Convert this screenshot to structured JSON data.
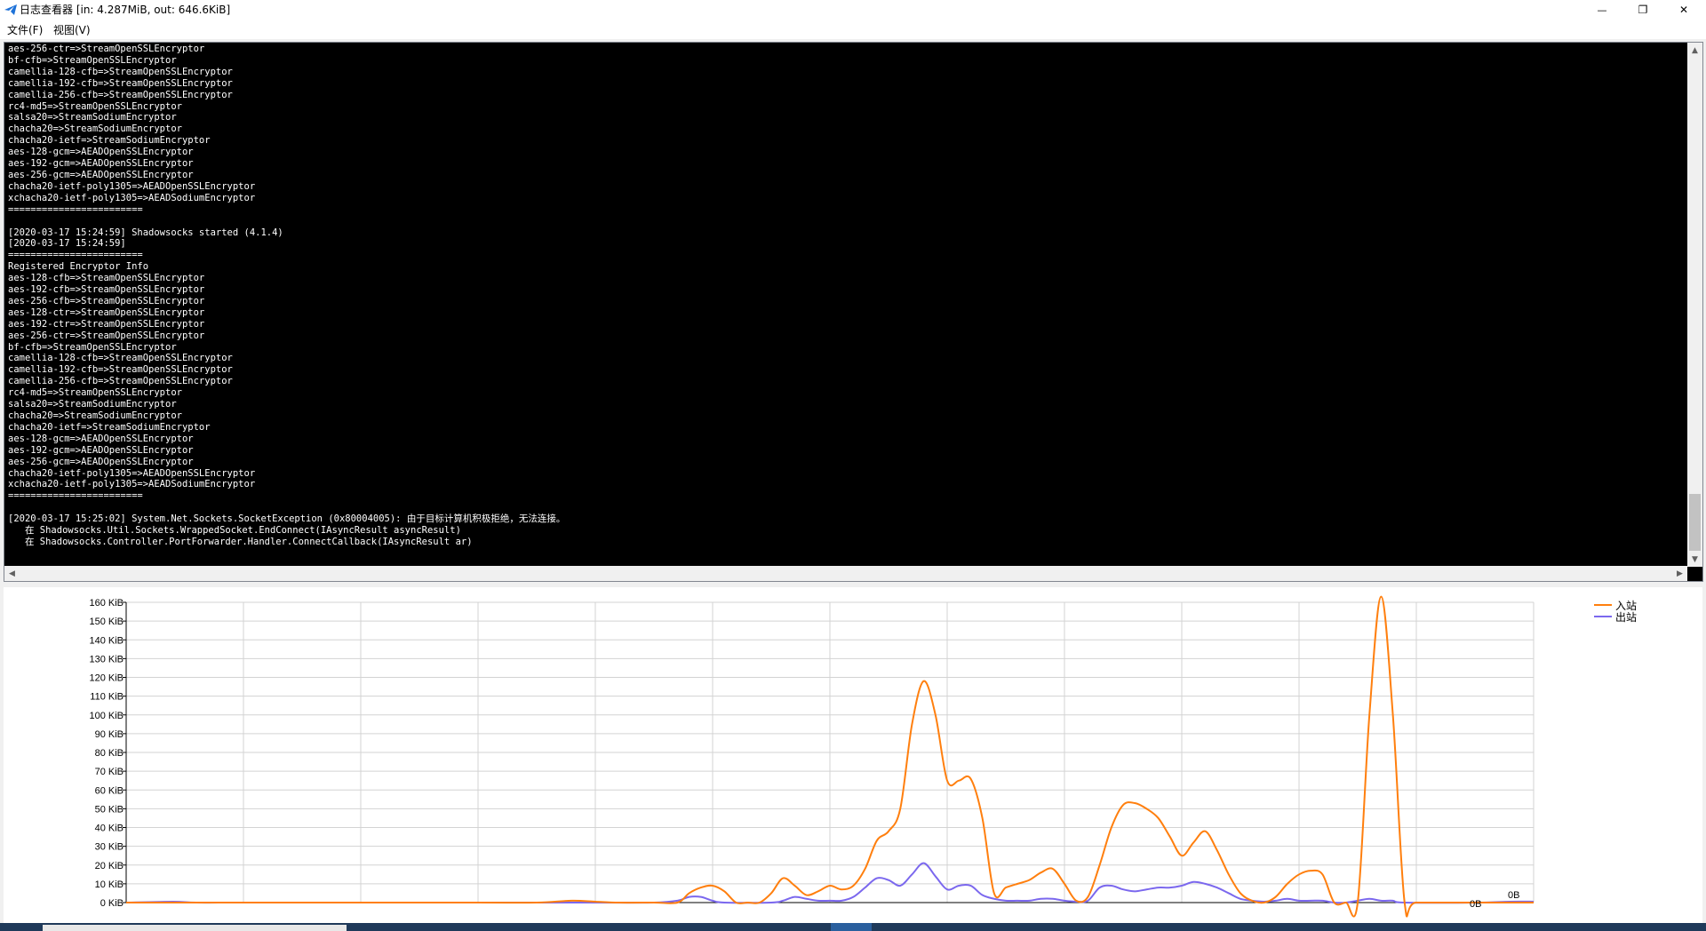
{
  "window": {
    "title": "日志查看器 [in: 4.287MiB, out: 646.6KiB]",
    "minimize_glyph": "—",
    "maximize_glyph": "❐",
    "close_glyph": "✕"
  },
  "menu": {
    "file": "文件(F)",
    "view": "视图(V)"
  },
  "log": {
    "lines": [
      "aes-256-ctr=>StreamOpenSSLEncryptor",
      "bf-cfb=>StreamOpenSSLEncryptor",
      "camellia-128-cfb=>StreamOpenSSLEncryptor",
      "camellia-192-cfb=>StreamOpenSSLEncryptor",
      "camellia-256-cfb=>StreamOpenSSLEncryptor",
      "rc4-md5=>StreamOpenSSLEncryptor",
      "salsa20=>StreamSodiumEncryptor",
      "chacha20=>StreamSodiumEncryptor",
      "chacha20-ietf=>StreamSodiumEncryptor",
      "aes-128-gcm=>AEADOpenSSLEncryptor",
      "aes-192-gcm=>AEADOpenSSLEncryptor",
      "aes-256-gcm=>AEADOpenSSLEncryptor",
      "chacha20-ietf-poly1305=>AEADOpenSSLEncryptor",
      "xchacha20-ietf-poly1305=>AEADSodiumEncryptor",
      "========================",
      "",
      "[2020-03-17 15:24:59] Shadowsocks started (4.1.4)",
      "[2020-03-17 15:24:59]",
      "========================",
      "Registered Encryptor Info",
      "aes-128-cfb=>StreamOpenSSLEncryptor",
      "aes-192-cfb=>StreamOpenSSLEncryptor",
      "aes-256-cfb=>StreamOpenSSLEncryptor",
      "aes-128-ctr=>StreamOpenSSLEncryptor",
      "aes-192-ctr=>StreamOpenSSLEncryptor",
      "aes-256-ctr=>StreamOpenSSLEncryptor",
      "bf-cfb=>StreamOpenSSLEncryptor",
      "camellia-128-cfb=>StreamOpenSSLEncryptor",
      "camellia-192-cfb=>StreamOpenSSLEncryptor",
      "camellia-256-cfb=>StreamOpenSSLEncryptor",
      "rc4-md5=>StreamOpenSSLEncryptor",
      "salsa20=>StreamSodiumEncryptor",
      "chacha20=>StreamSodiumEncryptor",
      "chacha20-ietf=>StreamSodiumEncryptor",
      "aes-128-gcm=>AEADOpenSSLEncryptor",
      "aes-192-gcm=>AEADOpenSSLEncryptor",
      "aes-256-gcm=>AEADOpenSSLEncryptor",
      "chacha20-ietf-poly1305=>AEADOpenSSLEncryptor",
      "xchacha20-ietf-poly1305=>AEADSodiumEncryptor",
      "========================",
      "",
      "[2020-03-17 15:25:02] System.Net.Sockets.SocketException (0x80004005): 由于目标计算机积极拒绝，无法连接。",
      "   在 Shadowsocks.Util.Sockets.WrappedSocket.EndConnect(IAsyncResult asyncResult)",
      "   在 Shadowsocks.Controller.PortForwarder.Handler.ConnectCallback(IAsyncResult ar)"
    ]
  },
  "chart_data": {
    "type": "line",
    "title": "",
    "xlabel": "",
    "ylabel": "",
    "ylim": [
      0,
      160
    ],
    "yticks": [
      "0 KiB",
      "10 KiB",
      "20 KiB",
      "30 KiB",
      "40 KiB",
      "50 KiB",
      "60 KiB",
      "70 KiB",
      "80 KiB",
      "90 KiB",
      "100 KiB",
      "110 KiB",
      "120 KiB",
      "130 KiB",
      "140 KiB",
      "150 KiB",
      "160 KiB"
    ],
    "xlim": [
      0,
      120
    ],
    "grid": true,
    "legend_position": "top-right",
    "series": [
      {
        "name": "入站",
        "color": "#ff7f0e",
        "points": [
          [
            0,
            0
          ],
          [
            5,
            0
          ],
          [
            10,
            0
          ],
          [
            20,
            0
          ],
          [
            30,
            0
          ],
          [
            35,
            0
          ],
          [
            38,
            1
          ],
          [
            40,
            0.5
          ],
          [
            42,
            0
          ],
          [
            45,
            0
          ],
          [
            47,
            0
          ],
          [
            48,
            5
          ],
          [
            49,
            8
          ],
          [
            50,
            9
          ],
          [
            51,
            6
          ],
          [
            52,
            0
          ],
          [
            53,
            0
          ],
          [
            54,
            0
          ],
          [
            55,
            5
          ],
          [
            56,
            13
          ],
          [
            57,
            9
          ],
          [
            58,
            4
          ],
          [
            59,
            6
          ],
          [
            60,
            9
          ],
          [
            61,
            7
          ],
          [
            62,
            9
          ],
          [
            63,
            18
          ],
          [
            64,
            33
          ],
          [
            65,
            38
          ],
          [
            66,
            50
          ],
          [
            67,
            95
          ],
          [
            68,
            118
          ],
          [
            69,
            100
          ],
          [
            70,
            65
          ],
          [
            71,
            65
          ],
          [
            72,
            66
          ],
          [
            73,
            45
          ],
          [
            74,
            5
          ],
          [
            75,
            8
          ],
          [
            76,
            10
          ],
          [
            77,
            12
          ],
          [
            78,
            16
          ],
          [
            79,
            18
          ],
          [
            80,
            10
          ],
          [
            81,
            1
          ],
          [
            82,
            3
          ],
          [
            83,
            20
          ],
          [
            84,
            40
          ],
          [
            85,
            52
          ],
          [
            86,
            53
          ],
          [
            87,
            50
          ],
          [
            88,
            45
          ],
          [
            89,
            35
          ],
          [
            90,
            25
          ],
          [
            91,
            32
          ],
          [
            92,
            38
          ],
          [
            93,
            28
          ],
          [
            94,
            15
          ],
          [
            95,
            5
          ],
          [
            96,
            1
          ],
          [
            97,
            0
          ],
          [
            98,
            3
          ],
          [
            99,
            10
          ],
          [
            100,
            15
          ],
          [
            101,
            17
          ],
          [
            102,
            15
          ],
          [
            103,
            0
          ],
          [
            104,
            0
          ],
          [
            105,
            0
          ],
          [
            106,
            100
          ],
          [
            107,
            163
          ],
          [
            108,
            100
          ],
          [
            109,
            0
          ],
          [
            110,
            0
          ],
          [
            115,
            0
          ],
          [
            120,
            0
          ]
        ]
      },
      {
        "name": "出站",
        "color": "#7b68ee",
        "points": [
          [
            0,
            0
          ],
          [
            4,
            0.5
          ],
          [
            6,
            0
          ],
          [
            10,
            0
          ],
          [
            20,
            0
          ],
          [
            30,
            0
          ],
          [
            40,
            0
          ],
          [
            45,
            0
          ],
          [
            47,
            1
          ],
          [
            48,
            3
          ],
          [
            49,
            3
          ],
          [
            50,
            1
          ],
          [
            51,
            0
          ],
          [
            55,
            0
          ],
          [
            56,
            1
          ],
          [
            57,
            3
          ],
          [
            58,
            2
          ],
          [
            59,
            1
          ],
          [
            60,
            1
          ],
          [
            61,
            1
          ],
          [
            62,
            3
          ],
          [
            63,
            8
          ],
          [
            64,
            13
          ],
          [
            65,
            12
          ],
          [
            66,
            9
          ],
          [
            67,
            15
          ],
          [
            68,
            21
          ],
          [
            69,
            14
          ],
          [
            70,
            7
          ],
          [
            71,
            9
          ],
          [
            72,
            9
          ],
          [
            73,
            4
          ],
          [
            74,
            2
          ],
          [
            75,
            1
          ],
          [
            76,
            1
          ],
          [
            77,
            1
          ],
          [
            78,
            2
          ],
          [
            79,
            2
          ],
          [
            80,
            1
          ],
          [
            81,
            0.5
          ],
          [
            82,
            1
          ],
          [
            83,
            8
          ],
          [
            84,
            9
          ],
          [
            85,
            7
          ],
          [
            86,
            6
          ],
          [
            87,
            7
          ],
          [
            88,
            8
          ],
          [
            89,
            8
          ],
          [
            90,
            9
          ],
          [
            91,
            11
          ],
          [
            92,
            10
          ],
          [
            93,
            8
          ],
          [
            94,
            5
          ],
          [
            95,
            2
          ],
          [
            96,
            1
          ],
          [
            97,
            0.5
          ],
          [
            98,
            1
          ],
          [
            99,
            2
          ],
          [
            100,
            1
          ],
          [
            101,
            1
          ],
          [
            102,
            1
          ],
          [
            103,
            0
          ],
          [
            104,
            0
          ],
          [
            105,
            1
          ],
          [
            106,
            2
          ],
          [
            107,
            1
          ],
          [
            108,
            1
          ],
          [
            109,
            0
          ],
          [
            115,
            0
          ],
          [
            118,
            0.5
          ],
          [
            120,
            0.5
          ]
        ]
      }
    ],
    "annotations": [
      "0B",
      "0B"
    ]
  }
}
